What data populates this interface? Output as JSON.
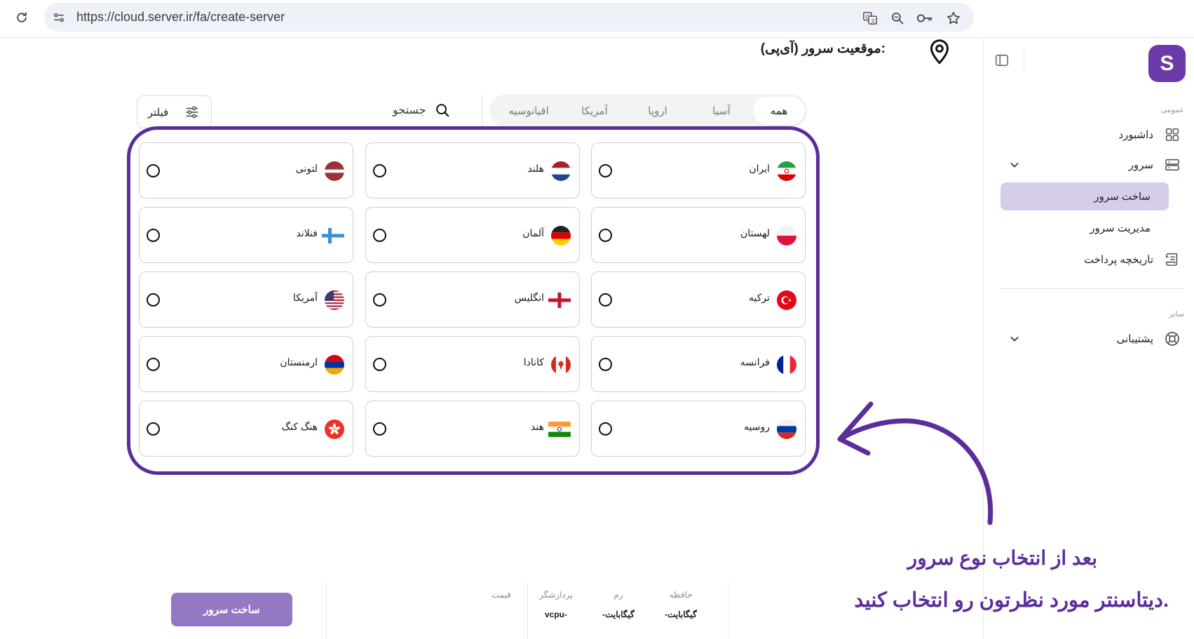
{
  "browser": {
    "url": "https://cloud.server.ir/fa/create-server"
  },
  "sidebar": {
    "logo_letter": "S",
    "section_general": "عمومی",
    "section_other": "سایر",
    "dashboard": "داشبورد",
    "server": "سرور",
    "create_server": "ساخت سرور",
    "manage_server": "مدیریت سرور",
    "payment_history": "تاریخچه پرداخت",
    "support": "پشتیبانی"
  },
  "main": {
    "heading": "موقعیت سرور (آی‌پی):",
    "tabs": [
      {
        "label": "همه",
        "active": true
      },
      {
        "label": "آسیا",
        "active": false
      },
      {
        "label": "اروپا",
        "active": false
      },
      {
        "label": "آمریکا",
        "active": false
      },
      {
        "label": "اقیانوسیه",
        "active": false
      }
    ],
    "search_label": "جستجو",
    "filter_label": "فیلتر"
  },
  "locations": [
    {
      "name": "ایران",
      "flag": "iran-flag-icon"
    },
    {
      "name": "هلند",
      "flag": "netherlands-flag-icon"
    },
    {
      "name": "لتونی",
      "flag": "latvia-flag-icon"
    },
    {
      "name": "لهستان",
      "flag": "poland-flag-icon"
    },
    {
      "name": "آلمان",
      "flag": "germany-flag-icon"
    },
    {
      "name": "فنلاند",
      "flag": "finland-flag-icon"
    },
    {
      "name": "ترکیه",
      "flag": "turkey-flag-icon"
    },
    {
      "name": "انگلیس",
      "flag": "england-flag-icon"
    },
    {
      "name": "آمریکا",
      "flag": "usa-flag-icon"
    },
    {
      "name": "فرانسه",
      "flag": "france-flag-icon"
    },
    {
      "name": "کانادا",
      "flag": "canada-flag-icon"
    },
    {
      "name": "ارمنستان",
      "flag": "armenia-flag-icon"
    },
    {
      "name": "روسیه",
      "flag": "russia-flag-icon"
    },
    {
      "name": "هند",
      "flag": "india-flag-icon"
    },
    {
      "name": "هنگ کنگ",
      "flag": "hongkong-flag-icon"
    }
  ],
  "annotation": {
    "line1": "بعد از انتخاب نوع سرور",
    "line2": "دیتاسنتر مورد نظرتون رو انتخاب کنید."
  },
  "summary": {
    "storage_label": "حافظه",
    "storage_value": "-گیگابایت",
    "ram_label": "رم",
    "ram_value": "-گیگابایت",
    "cpu_label": "پردازشگر",
    "cpu_value": "vcpu-",
    "price_label": "قیمت",
    "build_button": "ساخت سرور"
  },
  "colors": {
    "brand": "#6b3aa8",
    "annotation": "#5b2d9b",
    "active_sidebar": "#d6cde8",
    "button": "#9478c4"
  }
}
